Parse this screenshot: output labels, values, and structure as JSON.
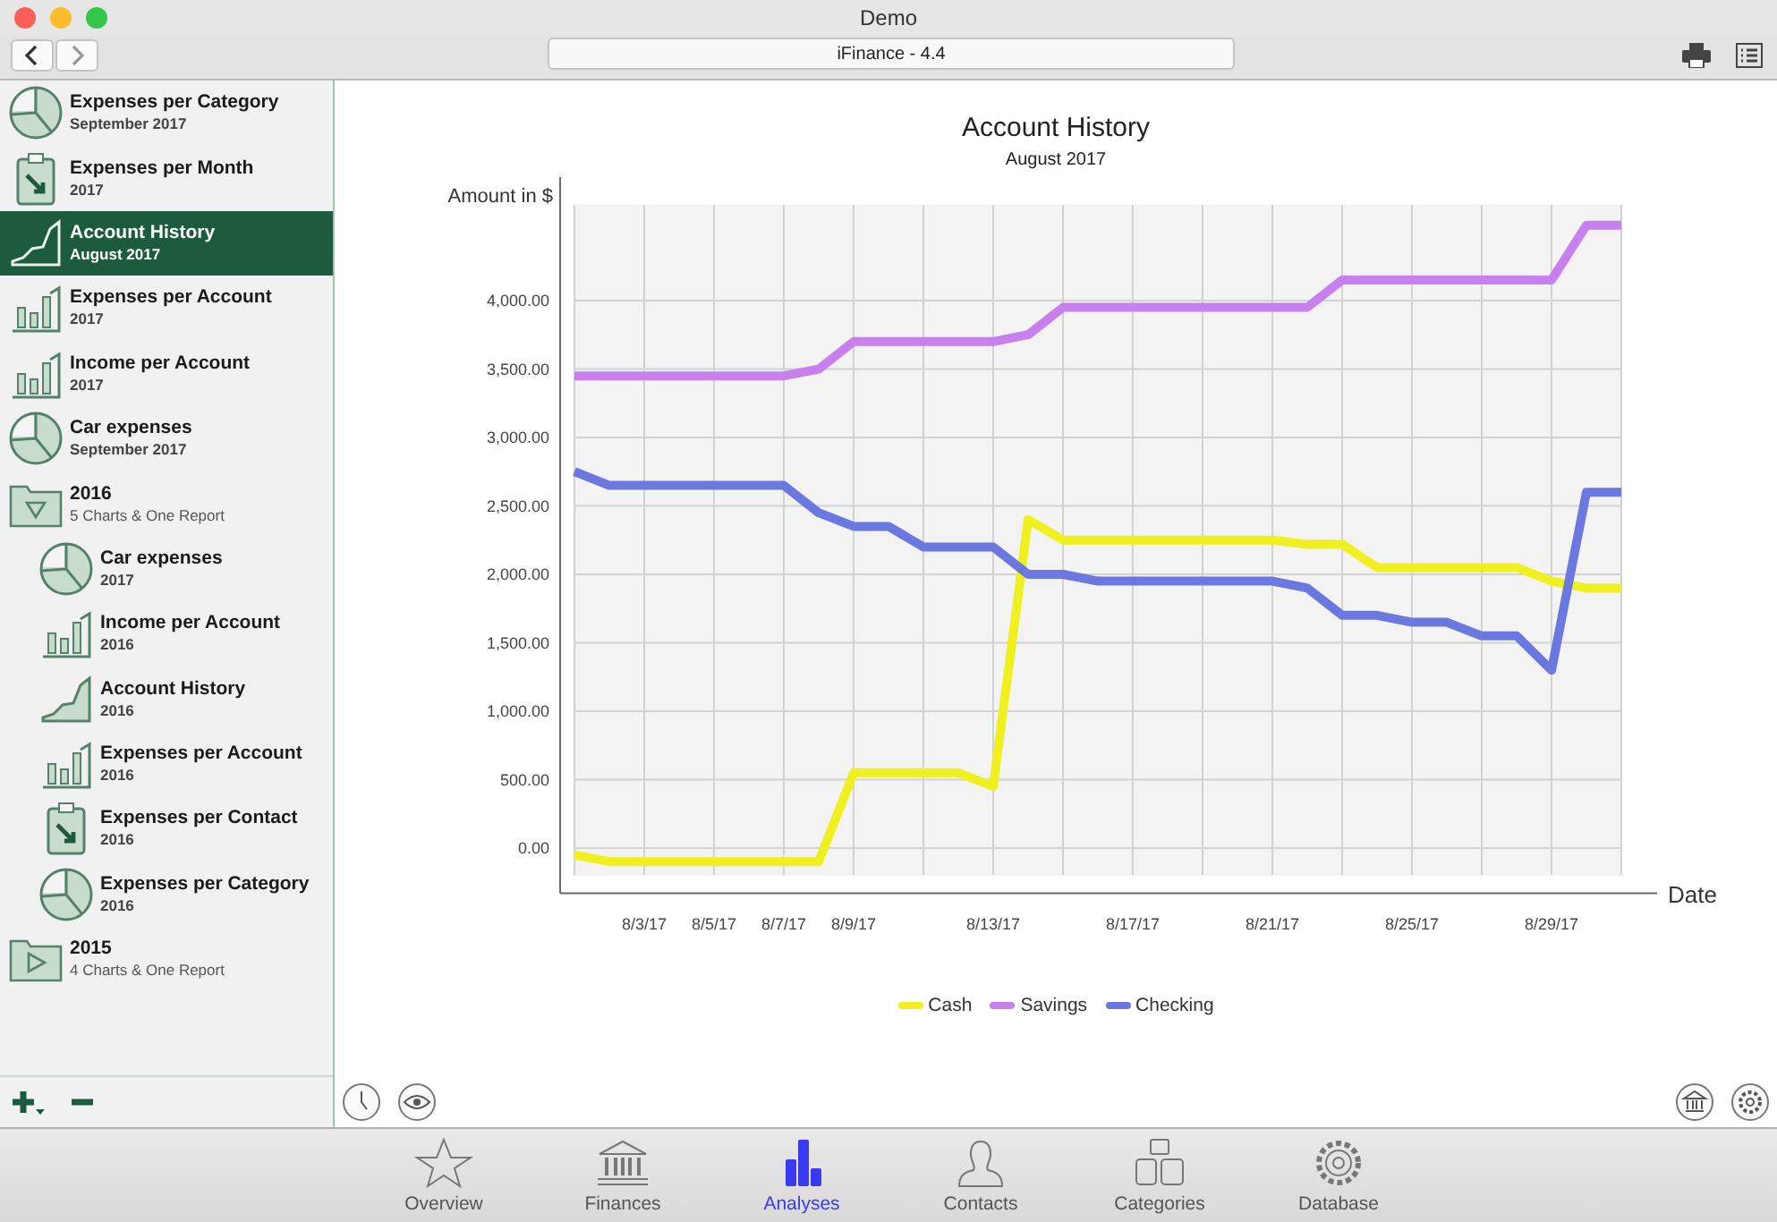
{
  "window": {
    "title": "Demo"
  },
  "toolbar": {
    "title": "iFinance - 4.4"
  },
  "sidebar": {
    "items": [
      {
        "kind": "pie",
        "title": "Expenses per Category",
        "subtitle": "September 2017",
        "selected": false
      },
      {
        "kind": "clipboard",
        "title": "Expenses per Month",
        "subtitle": "2017",
        "selected": false
      },
      {
        "kind": "line",
        "title": "Account History",
        "subtitle": "August 2017",
        "selected": true
      },
      {
        "kind": "bar",
        "title": "Expenses per Account",
        "subtitle": "2017",
        "selected": false
      },
      {
        "kind": "bar",
        "title": "Income per Account",
        "subtitle": "2017",
        "selected": false
      },
      {
        "kind": "pie",
        "title": "Car expenses",
        "subtitle": "September 2017",
        "selected": false
      },
      {
        "kind": "folder",
        "title": "2016",
        "subtitle": "5 Charts & One Report",
        "selected": false,
        "expanded": true,
        "children": [
          {
            "kind": "pie",
            "title": "Car expenses",
            "subtitle": "2017",
            "selected": false
          },
          {
            "kind": "bar",
            "title": "Income per Account",
            "subtitle": "2016",
            "selected": false
          },
          {
            "kind": "line",
            "title": "Account History",
            "subtitle": "2016",
            "selected": false
          },
          {
            "kind": "bar",
            "title": "Expenses per Account",
            "subtitle": "2016",
            "selected": false
          },
          {
            "kind": "clipboard",
            "title": "Expenses per Contact",
            "subtitle": "2016",
            "selected": false
          },
          {
            "kind": "pie",
            "title": "Expenses per Category",
            "subtitle": "2016",
            "selected": false
          }
        ]
      },
      {
        "kind": "folder",
        "title": "2015",
        "subtitle": "4 Charts & One Report",
        "selected": false,
        "expanded": false
      }
    ]
  },
  "report": {
    "title": "Account History",
    "subtitle": "August 2017",
    "chart_data": {
      "type": "line",
      "grid": true,
      "xlabel": "Date",
      "ylabel": "Amount in $",
      "ylim": [
        -200,
        4700
      ],
      "categories": [
        null,
        null,
        "8/3/17",
        null,
        "8/5/17",
        null,
        "8/7/17",
        null,
        "8/9/17",
        null,
        null,
        null,
        "8/13/17",
        null,
        null,
        null,
        "8/17/17",
        null,
        null,
        null,
        "8/21/17",
        null,
        null,
        null,
        "8/25/17",
        null,
        null,
        null,
        "8/29/17",
        null,
        null
      ],
      "yticks": [
        {
          "value": 0,
          "label": "0.00"
        },
        {
          "value": 500,
          "label": "500.00"
        },
        {
          "value": 1000,
          "label": "1,000.00"
        },
        {
          "value": 1500,
          "label": "1,500.00"
        },
        {
          "value": 2000,
          "label": "2,000.00"
        },
        {
          "value": 2500,
          "label": "2,500.00"
        },
        {
          "value": 3000,
          "label": "3,000.00"
        },
        {
          "value": 3500,
          "label": "3,500.00"
        },
        {
          "value": 4000,
          "label": "4,000.00"
        }
      ],
      "series": [
        {
          "name": "Cash",
          "color": "#f0f020",
          "values": [
            -50,
            -100,
            -100,
            -100,
            -100,
            -100,
            -100,
            -100,
            550,
            550,
            550,
            550,
            450,
            2400,
            2250,
            2250,
            2250,
            2250,
            2250,
            2250,
            2250,
            2220,
            2220,
            2050,
            2050,
            2050,
            2050,
            2050,
            1950,
            1900,
            1900
          ]
        },
        {
          "name": "Savings",
          "color": "#c880ee",
          "values": [
            3450,
            3450,
            3450,
            3450,
            3450,
            3450,
            3450,
            3500,
            3700,
            3700,
            3700,
            3700,
            3700,
            3750,
            3950,
            3950,
            3950,
            3950,
            3950,
            3950,
            3950,
            3950,
            4150,
            4150,
            4150,
            4150,
            4150,
            4150,
            4150,
            4550,
            4550
          ]
        },
        {
          "name": "Checking",
          "color": "#6a78e0",
          "values": [
            2750,
            2650,
            2650,
            2650,
            2650,
            2650,
            2650,
            2450,
            2350,
            2350,
            2200,
            2200,
            2200,
            2000,
            2000,
            1950,
            1950,
            1950,
            1950,
            1950,
            1950,
            1900,
            1700,
            1700,
            1650,
            1650,
            1550,
            1550,
            1300,
            2600,
            2600
          ]
        }
      ]
    }
  },
  "tabs": [
    {
      "label": "Overview",
      "selected": false
    },
    {
      "label": "Finances",
      "selected": false
    },
    {
      "label": "Analyses",
      "selected": true
    },
    {
      "label": "Contacts",
      "selected": false
    },
    {
      "label": "Categories",
      "selected": false
    },
    {
      "label": "Database",
      "selected": false
    }
  ]
}
